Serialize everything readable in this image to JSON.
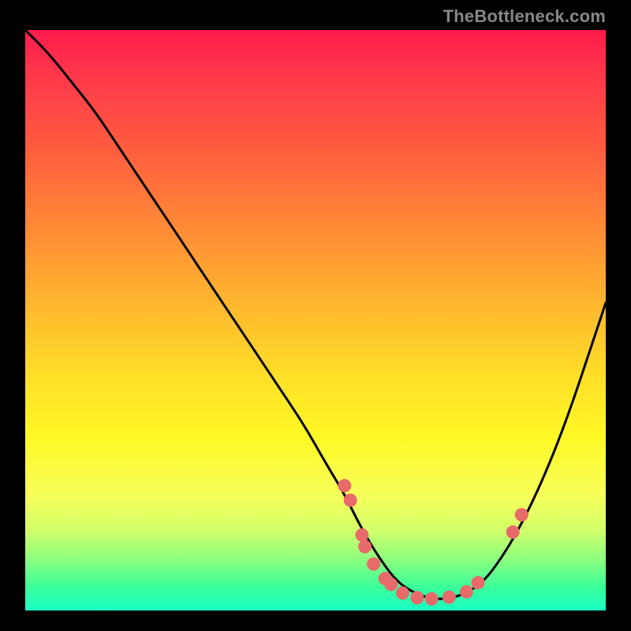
{
  "watermark": "TheBottleneck.com",
  "chart_data": {
    "type": "line",
    "title": "",
    "xlabel": "",
    "ylabel": "",
    "xlim": [
      0,
      100
    ],
    "ylim": [
      0,
      100
    ],
    "series": [
      {
        "name": "curve",
        "x": [
          0,
          4,
          8,
          12,
          16,
          20,
          24,
          28,
          32,
          36,
          40,
          44,
          48,
          52,
          55,
          58,
          61,
          64,
          67,
          70,
          73,
          76,
          79,
          82,
          85,
          88,
          91,
          94,
          97,
          100
        ],
        "y": [
          100,
          96,
          91,
          86,
          80,
          74,
          68,
          62,
          56,
          50,
          44,
          38,
          32,
          25,
          20,
          14,
          9,
          5,
          3,
          2,
          2,
          3,
          5,
          9,
          14,
          20,
          27,
          35,
          44,
          53
        ]
      }
    ],
    "points": [
      {
        "x": 55.0,
        "y": 21.5
      },
      {
        "x": 56.0,
        "y": 19.0
      },
      {
        "x": 58.0,
        "y": 13.0
      },
      {
        "x": 58.5,
        "y": 11.0
      },
      {
        "x": 60.0,
        "y": 8.0
      },
      {
        "x": 62.0,
        "y": 5.5
      },
      {
        "x": 63.0,
        "y": 4.5
      },
      {
        "x": 65.0,
        "y": 3.0
      },
      {
        "x": 67.5,
        "y": 2.2
      },
      {
        "x": 70.0,
        "y": 2.0
      },
      {
        "x": 73.0,
        "y": 2.3
      },
      {
        "x": 76.0,
        "y": 3.2
      },
      {
        "x": 78.0,
        "y": 4.8
      },
      {
        "x": 84.0,
        "y": 13.5
      },
      {
        "x": 85.5,
        "y": 16.5
      }
    ],
    "gradient_stops": [
      "#ff1a4d",
      "#ff8a36",
      "#ffe028",
      "#d4ff6a",
      "#19ffc5"
    ]
  }
}
